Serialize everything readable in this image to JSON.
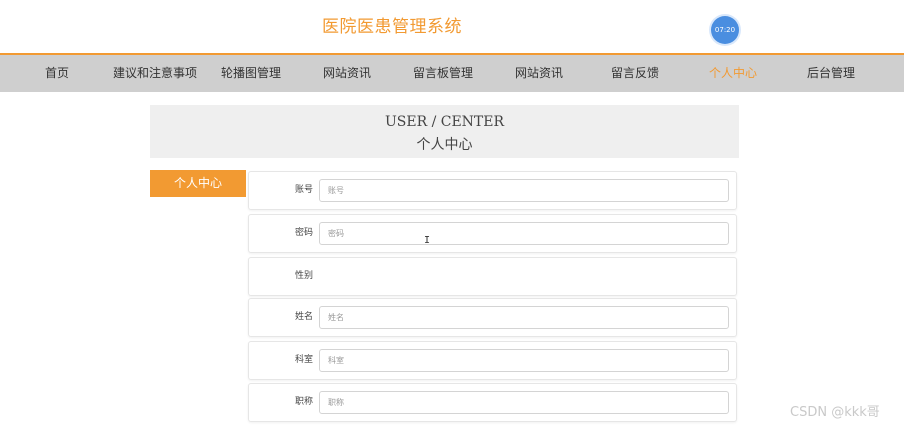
{
  "header": {
    "title": "医院医患管理系统",
    "clock": "07:20"
  },
  "nav": {
    "items": [
      {
        "label": "首页"
      },
      {
        "label": "建议和注意事项"
      },
      {
        "label": "轮播图管理"
      },
      {
        "label": "网站资讯"
      },
      {
        "label": "留言板管理"
      },
      {
        "label": "网站资讯"
      },
      {
        "label": "留言反馈"
      },
      {
        "label": "个人中心"
      },
      {
        "label": "后台管理"
      }
    ],
    "active_index": 7
  },
  "banner": {
    "en": "USER / CENTER",
    "cn": "个人中心"
  },
  "sidebar": {
    "items": [
      {
        "label": "个人中心"
      }
    ]
  },
  "form": {
    "fields": [
      {
        "label": "账号",
        "placeholder": "账号",
        "value": ""
      },
      {
        "label": "密码",
        "placeholder": "密码",
        "value": ""
      },
      {
        "label": "性别"
      },
      {
        "label": "姓名",
        "placeholder": "姓名",
        "value": ""
      },
      {
        "label": "科室",
        "placeholder": "科室",
        "value": ""
      },
      {
        "label": "职称",
        "placeholder": "职称",
        "value": ""
      }
    ]
  },
  "watermark": "CSDN @kkk哥",
  "colors": {
    "accent": "#f29a32",
    "nav_bg": "#cfcfcf",
    "banner_bg": "#efefef",
    "clock": "#4a8ee0"
  }
}
